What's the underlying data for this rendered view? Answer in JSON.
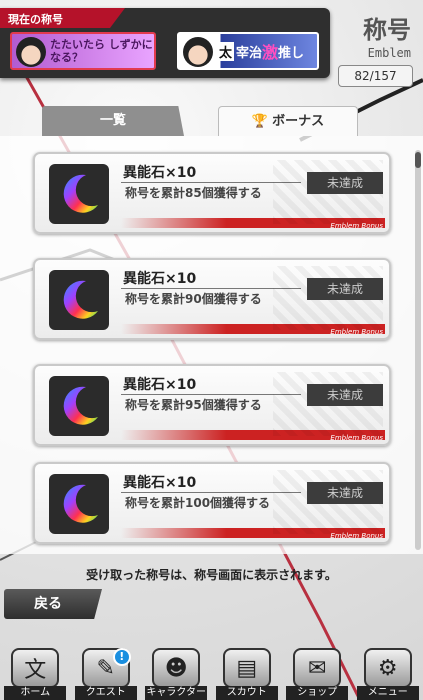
{
  "header": {
    "current_label": "現在の称号",
    "plate_a_text": "たたいたら しずかになる？",
    "plate_b_tai": "太",
    "plate_b_mid": "宰治",
    "plate_b_geki": "激",
    "plate_b_end": "推し",
    "title": "称号",
    "subtitle": "Emblem",
    "count": "82/157"
  },
  "tabs": [
    {
      "label": "一覧"
    },
    {
      "label": "ボーナス"
    }
  ],
  "cards": [
    {
      "reward": "異能石×10",
      "condition": "称号を累計85個獲得する",
      "status": "未達成",
      "band": "Emblem Bonus"
    },
    {
      "reward": "異能石×10",
      "condition": "称号を累計90個獲得する",
      "status": "未達成",
      "band": "Emblem Bonus"
    },
    {
      "reward": "異能石×10",
      "condition": "称号を累計95個獲得する",
      "status": "未達成",
      "band": "Emblem Bonus"
    },
    {
      "reward": "異能石×10",
      "condition": "称号を累計100個獲得する",
      "status": "未達成",
      "band": "Emblem Bonus"
    }
  ],
  "notice": "受け取った称号は、称号画面に表示されます。",
  "back_label": "戻る",
  "nav": [
    {
      "label": "ホーム",
      "icon": "home-icon",
      "glyph": "文"
    },
    {
      "label": "クエスト",
      "icon": "quest-icon",
      "glyph": "✎",
      "badge": "!"
    },
    {
      "label": "キャラクター",
      "icon": "character-icon",
      "glyph": "☻"
    },
    {
      "label": "スカウト",
      "icon": "scout-icon",
      "glyph": "▤"
    },
    {
      "label": "ショップ",
      "icon": "shop-icon",
      "glyph": "✉"
    },
    {
      "label": "メニュー",
      "icon": "menu-icon",
      "glyph": "⚙"
    }
  ],
  "colors": {
    "accent": "#b5122a",
    "status_bg": "#3c3c3c"
  }
}
